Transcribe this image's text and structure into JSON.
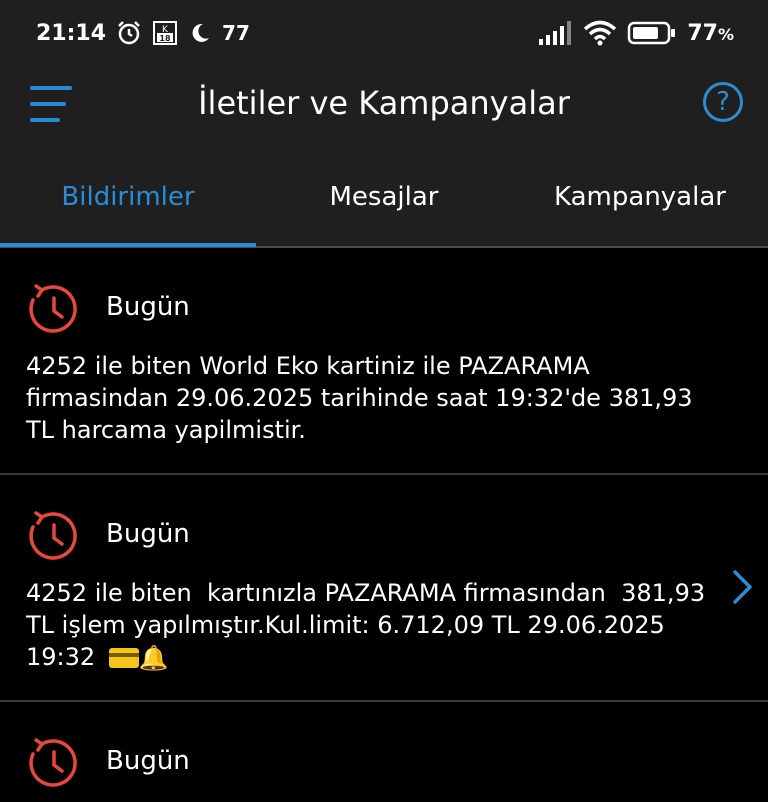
{
  "status_bar": {
    "time": "21:14",
    "notif_count": "77",
    "battery_level": "77",
    "battery_unit": "%"
  },
  "header": {
    "title": "İletiler ve Kampanyalar",
    "help_symbol": "?"
  },
  "tabs": [
    {
      "label": "Bildirimler",
      "active": true
    },
    {
      "label": "Mesajlar",
      "active": false
    },
    {
      "label": "Kampanyalar",
      "active": false
    }
  ],
  "notifications": [
    {
      "date_label": "Bugün",
      "text": "4252 ile biten World Eko kartiniz ile PAZARAMA firmasindan 29.06.2025 tarihinde saat 19:32'de 381,93 TL harcama yapilmistir.",
      "has_chevron": false
    },
    {
      "date_label": "Bugün",
      "text": "4252 ile biten  kartınızla PAZARAMA firmasından  381,93 TL işlem yapılmıştır.Kul.limit: 6.712,09 TL 29.06.2025  19:32",
      "has_chevron": true
    },
    {
      "date_label": "Bugün",
      "text": "",
      "has_chevron": false
    }
  ],
  "icons": {
    "menu": "hamburger-menu-icon",
    "help": "help-icon",
    "history": "clock-history-icon",
    "chevron": "chevron-right-icon"
  },
  "colors": {
    "accent": "#2b8cd6",
    "icon_red": "#e8473c",
    "bar_bg": "#1f1f1f",
    "list_bg": "#000000"
  }
}
